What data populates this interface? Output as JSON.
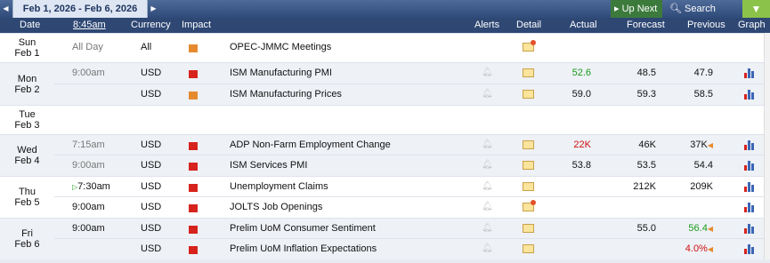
{
  "toolbar": {
    "prev_label": "◀",
    "date_range": "Feb 1, 2026 - Feb 6, 2026",
    "next_label": "▶",
    "up_next": "Up Next",
    "search_events": "Search Events",
    "filter_icon": "filter-icon"
  },
  "columns": {
    "date": "Date",
    "time": "8:45am",
    "currency": "Currency",
    "impact": "Impact",
    "alerts": "Alerts",
    "detail": "Detail",
    "actual": "Actual",
    "forecast": "Forecast",
    "previous": "Previous",
    "graph": "Graph"
  },
  "days": [
    {
      "day": "Sun",
      "date": "Feb 1"
    },
    {
      "day": "Mon",
      "date": "Feb 2"
    },
    {
      "day": "Tue",
      "date": "Feb 3"
    },
    {
      "day": "Wed",
      "date": "Feb 4"
    },
    {
      "day": "Thu",
      "date": "Feb 5"
    },
    {
      "day": "Fri",
      "date": "Feb 6"
    }
  ],
  "events": [
    {
      "time": "All Day",
      "currency": "All",
      "impact": "medium",
      "event": "OPEC-JMMC Meetings",
      "actual": "",
      "forecast": "",
      "previous": ""
    },
    {
      "time": "9:00am",
      "currency": "USD",
      "impact": "high",
      "event": "ISM Manufacturing PMI",
      "actual": "52.6",
      "forecast": "48.5",
      "previous": "47.9"
    },
    {
      "time": "",
      "currency": "USD",
      "impact": "medium",
      "event": "ISM Manufacturing Prices",
      "actual": "59.0",
      "forecast": "59.3",
      "previous": "58.5"
    },
    {
      "time": "7:15am",
      "currency": "USD",
      "impact": "high",
      "event": "ADP Non-Farm Employment Change",
      "actual": "22K",
      "forecast": "46K",
      "previous": "37K"
    },
    {
      "time": "9:00am",
      "currency": "USD",
      "impact": "high",
      "event": "ISM Services PMI",
      "actual": "53.8",
      "forecast": "53.5",
      "previous": "54.4"
    },
    {
      "time": "7:30am",
      "currency": "USD",
      "impact": "high",
      "event": "Unemployment Claims",
      "actual": "",
      "forecast": "212K",
      "previous": "209K"
    },
    {
      "time": "9:00am",
      "currency": "USD",
      "impact": "high",
      "event": "JOLTS Job Openings",
      "actual": "",
      "forecast": "",
      "previous": ""
    },
    {
      "time": "9:00am",
      "currency": "USD",
      "impact": "high",
      "event": "Prelim UoM Consumer Sentiment",
      "actual": "",
      "forecast": "55.0",
      "previous": "56.4"
    },
    {
      "time": "",
      "currency": "USD",
      "impact": "high",
      "event": "Prelim UoM Inflation Expectations",
      "actual": "",
      "forecast": "",
      "previous": "4.0%"
    }
  ],
  "colors": {
    "header_bg": "#2e4773",
    "band": "#eef1f6",
    "high_impact": "#d6231d",
    "medium_impact": "#e68a2e",
    "better": "#1a9a1a",
    "worse": "#cc1111"
  }
}
